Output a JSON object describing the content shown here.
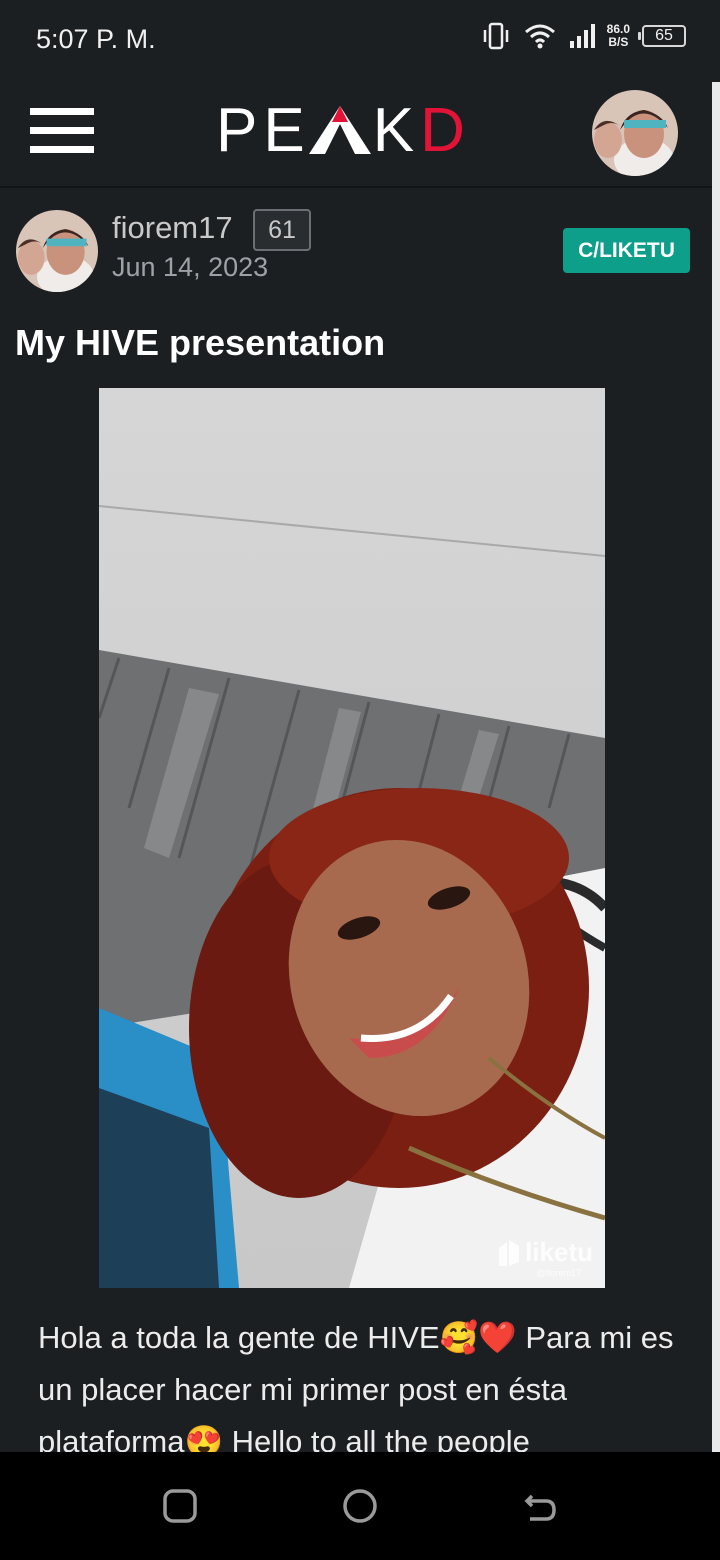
{
  "status_bar": {
    "time": "5:07 P. M.",
    "net_speed_value": "86.0",
    "net_speed_unit": "B/S",
    "battery_level": "65"
  },
  "header": {
    "logo_part1": "PE",
    "logo_part2": "K",
    "logo_part3": "D"
  },
  "post": {
    "author": "fiorem17",
    "reputation": "61",
    "date": "Jun 14, 2023",
    "community": "C/LIKETU",
    "title": "My HIVE presentation",
    "watermark": "liketu",
    "watermark_user": "@fiorem17",
    "body": "Hola a toda la gente de HIVE🥰❤️ Para mi es un placer hacer mi primer post en ésta plataforma😍 Hello to all the people"
  },
  "colors": {
    "background": "#1c1f22",
    "accent_red": "#e31337",
    "community_teal": "#0e9f8b"
  },
  "icons": {
    "menu": "hamburger-menu-icon",
    "vibrate": "vibrate-icon",
    "wifi": "wifi-icon",
    "signal": "signal-icon",
    "battery": "battery-icon",
    "nav_recents": "recents-icon",
    "nav_home": "home-icon",
    "nav_back": "back-icon"
  }
}
